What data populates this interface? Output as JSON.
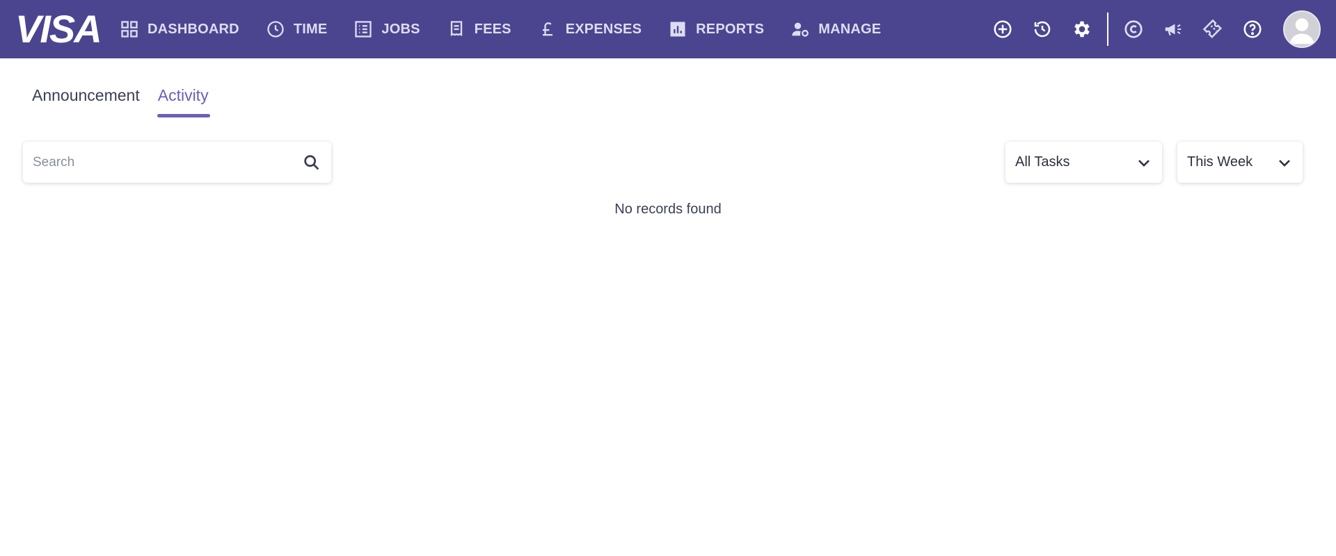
{
  "header": {
    "logo_text": "VISA",
    "bar_color": "#4b4590",
    "nav": [
      {
        "label": "DASHBOARD",
        "icon": "dashboard-grid-icon"
      },
      {
        "label": "TIME",
        "icon": "clock-icon"
      },
      {
        "label": "JOBS",
        "icon": "list-icon"
      },
      {
        "label": "FEES",
        "icon": "receipt-icon"
      },
      {
        "label": "EXPENSES",
        "icon": "pound-icon"
      },
      {
        "label": "REPORTS",
        "icon": "bar-chart-icon"
      },
      {
        "label": "MANAGE",
        "icon": "user-gear-icon"
      }
    ],
    "right_icons": [
      "add-circle-icon",
      "history-icon",
      "gear-icon",
      "c-logo-icon",
      "megaphone-icon",
      "ticket-icon",
      "help-icon",
      "avatar"
    ]
  },
  "tabs": [
    {
      "label": "Announcement",
      "active": false
    },
    {
      "label": "Activity",
      "active": true
    }
  ],
  "search": {
    "placeholder": "Search"
  },
  "filters": {
    "task_filter": "All Tasks",
    "period_filter": "This Week"
  },
  "empty_message": "No records found",
  "accent_color": "#6b5fb8"
}
